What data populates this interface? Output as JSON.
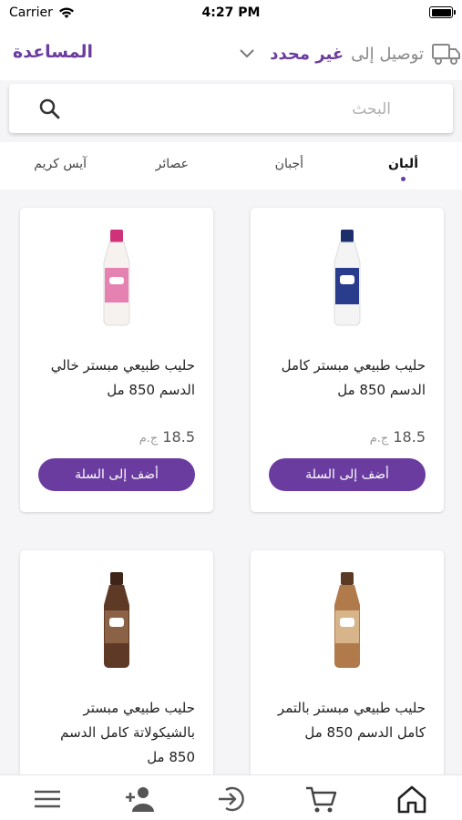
{
  "status_bar": {
    "carrier": "Carrier",
    "time": "4:27 PM"
  },
  "header": {
    "help": "المساعدة",
    "delivery_label": "توصيل إلى",
    "delivery_value": "غير محدد"
  },
  "search": {
    "placeholder": "البحث"
  },
  "tabs": [
    {
      "label": "ألبان",
      "active": true
    },
    {
      "label": "أجبان"
    },
    {
      "label": "عصائر"
    },
    {
      "label": "آيس كريم"
    }
  ],
  "products": [
    {
      "name": "حليب طبيعي مبستر كامل الدسم 850 مل",
      "price": "18.5",
      "currency": "ج.م",
      "button": "أضف إلى السلة",
      "cap": "#1c2f6b",
      "body": "#f4f4f4",
      "label": "#2a3d8c"
    },
    {
      "name": "حليب طبيعي مبستر خالي الدسم 850 مل",
      "price": "18.5",
      "currency": "ج.م",
      "button": "أضف إلى السلة",
      "cap": "#d0327a",
      "body": "#f6f2f0",
      "label": "#e582b2"
    },
    {
      "name": "حليب طبيعي مبستر بالتمر كامل الدسم 850 مل",
      "cap": "#5a3a22",
      "body": "#b07a4a",
      "label": "#d8b48a"
    },
    {
      "name": "حليب طبيعي مبستر بالشيكولاتة كامل الدسم 850 مل",
      "cap": "#3e2518",
      "body": "#5e3a26",
      "label": "#8c6246"
    }
  ],
  "bottom_nav": [
    {
      "icon": "home-icon"
    },
    {
      "icon": "cart-icon"
    },
    {
      "icon": "login-icon"
    },
    {
      "icon": "add-user-icon"
    },
    {
      "icon": "menu-icon"
    }
  ],
  "colors": {
    "accent": "#6a3ca0"
  }
}
